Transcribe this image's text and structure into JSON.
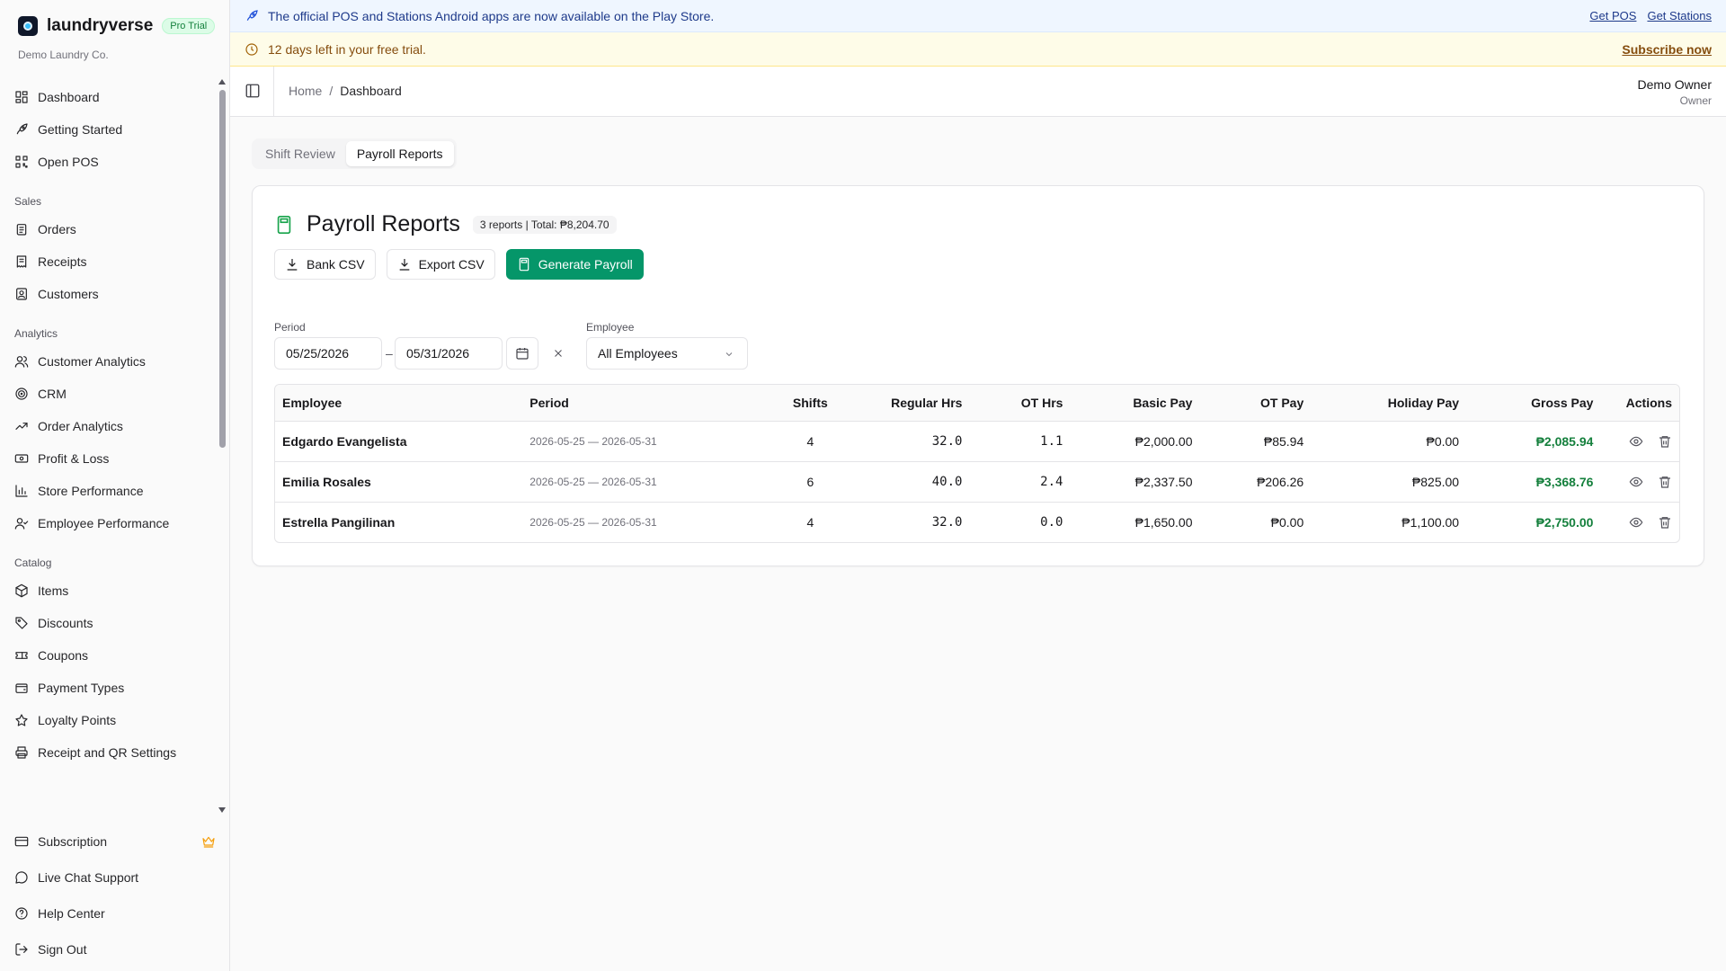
{
  "brand": {
    "name": "laundryverse",
    "badge": "Pro Trial",
    "company": "Demo Laundry Co."
  },
  "sidebar": {
    "top": [
      {
        "label": "Dashboard",
        "icon": "dashboard-icon"
      },
      {
        "label": "Getting Started",
        "icon": "rocket-icon"
      },
      {
        "label": "Open POS",
        "icon": "qr-code-icon"
      }
    ],
    "sections": [
      {
        "title": "Sales",
        "items": [
          {
            "label": "Orders",
            "icon": "clipboard-icon"
          },
          {
            "label": "Receipts",
            "icon": "receipt-icon"
          },
          {
            "label": "Customers",
            "icon": "contact-icon"
          }
        ]
      },
      {
        "title": "Analytics",
        "items": [
          {
            "label": "Customer Analytics",
            "icon": "users-icon"
          },
          {
            "label": "CRM",
            "icon": "target-icon"
          },
          {
            "label": "Order Analytics",
            "icon": "trending-up-icon"
          },
          {
            "label": "Profit & Loss",
            "icon": "banknote-icon"
          },
          {
            "label": "Store Performance",
            "icon": "bar-chart-icon"
          },
          {
            "label": "Employee Performance",
            "icon": "user-check-icon"
          }
        ]
      },
      {
        "title": "Catalog",
        "items": [
          {
            "label": "Items",
            "icon": "package-icon"
          },
          {
            "label": "Discounts",
            "icon": "tag-icon"
          },
          {
            "label": "Coupons",
            "icon": "ticket-icon"
          },
          {
            "label": "Payment Types",
            "icon": "wallet-icon"
          },
          {
            "label": "Loyalty Points",
            "icon": "star-icon"
          },
          {
            "label": "Receipt and QR Settings",
            "icon": "printer-icon"
          }
        ]
      }
    ],
    "bottom": [
      {
        "label": "Subscription",
        "icon": "credit-card-icon"
      },
      {
        "label": "Live Chat Support",
        "icon": "message-circle-icon"
      },
      {
        "label": "Help Center",
        "icon": "help-circle-icon"
      },
      {
        "label": "Sign Out",
        "icon": "log-out-icon"
      }
    ]
  },
  "banners": {
    "apps": {
      "text": "The official POS and Stations Android apps are now available on the Play Store.",
      "link_pos": "Get POS",
      "link_stations": "Get Stations"
    },
    "trial": {
      "text": "12 days left in your free trial.",
      "link": "Subscribe now"
    }
  },
  "header": {
    "breadcrumb": {
      "home": "Home",
      "separator": "/",
      "current": "Dashboard"
    },
    "user": {
      "name": "Demo Owner",
      "role": "Owner"
    }
  },
  "tabs": [
    {
      "label": "Shift Review",
      "active": false
    },
    {
      "label": "Payroll Reports",
      "active": true
    }
  ],
  "card": {
    "title": "Payroll Reports",
    "badge": "3 reports | Total: ₱8,204.70",
    "buttons": {
      "bank_csv": "Bank CSV",
      "export_csv": "Export CSV",
      "generate": "Generate Payroll"
    },
    "filters": {
      "period_label": "Period",
      "start_date": "05/25/2026",
      "end_date": "05/31/2026",
      "range_separator": "–",
      "employee_label": "Employee",
      "employee_value": "All Employees"
    }
  },
  "table": {
    "columns": [
      "Employee",
      "Period",
      "Shifts",
      "Regular Hrs",
      "OT Hrs",
      "Basic Pay",
      "OT Pay",
      "Holiday Pay",
      "Gross Pay",
      "Actions"
    ],
    "rows": [
      {
        "employee": "Edgardo Evangelista",
        "period": "2026-05-25 — 2026-05-31",
        "shifts": "4",
        "regular_hrs": "32.0",
        "ot_hrs": "1.1",
        "basic_pay": "₱2,000.00",
        "ot_pay": "₱85.94",
        "holiday_pay": "₱0.00",
        "gross_pay": "₱2,085.94"
      },
      {
        "employee": "Emilia Rosales",
        "period": "2026-05-25 — 2026-05-31",
        "shifts": "6",
        "regular_hrs": "40.0",
        "ot_hrs": "2.4",
        "basic_pay": "₱2,337.50",
        "ot_pay": "₱206.26",
        "holiday_pay": "₱825.00",
        "gross_pay": "₱3,368.76"
      },
      {
        "employee": "Estrella Pangilinan",
        "period": "2026-05-25 — 2026-05-31",
        "shifts": "4",
        "regular_hrs": "32.0",
        "ot_hrs": "0.0",
        "basic_pay": "₱1,650.00",
        "ot_pay": "₱0.00",
        "holiday_pay": "₱1,100.00",
        "gross_pay": "₱2,750.00"
      }
    ]
  },
  "colors": {
    "primary": "#059669",
    "gross_pay": "#15803d",
    "banner_blue": "#eff6ff",
    "banner_yellow": "#fefce8"
  }
}
